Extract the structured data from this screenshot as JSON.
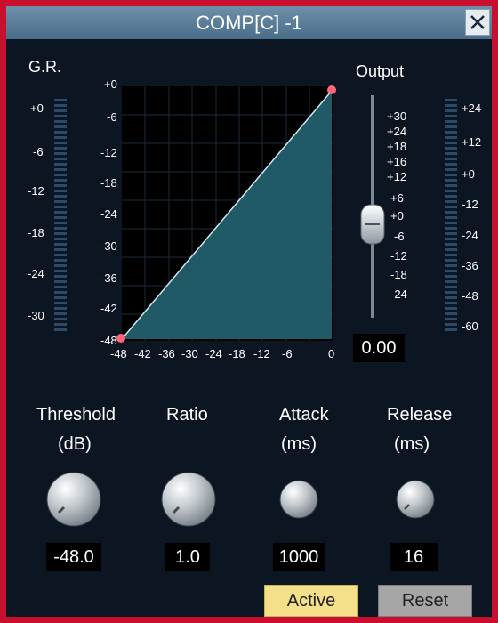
{
  "window": {
    "title": "COMP[C] -1"
  },
  "gr_meter": {
    "label": "G.R.",
    "ticks": [
      "+0",
      "-6",
      "-12",
      "-18",
      "-24",
      "-30"
    ]
  },
  "curve_graph": {
    "y_ticks": [
      "+0",
      "-6",
      "-12",
      "-18",
      "-24",
      "-30",
      "-36",
      "-42",
      "-48"
    ],
    "x_ticks": [
      "-48",
      "-42",
      "-36",
      "-30",
      "-24",
      "-18",
      "-12",
      "-6",
      "0"
    ]
  },
  "output": {
    "label": "Output",
    "fader_ticks": [
      "+30",
      "+24",
      "+18",
      "+16",
      "+12",
      "+6",
      "+0",
      "-6",
      "-12",
      "-18",
      "-24"
    ],
    "value": "0.00",
    "meter_ticks": [
      "+24",
      "+12",
      "+0",
      "-12",
      "-24",
      "-36",
      "-48",
      "-60"
    ]
  },
  "controls": {
    "threshold": {
      "label": "Threshold",
      "unit": "(dB)",
      "value": "-48.0"
    },
    "ratio": {
      "label": "Ratio",
      "value": "1.0"
    },
    "attack": {
      "label": "Attack",
      "unit": "(ms)",
      "value": "1000"
    },
    "release": {
      "label": "Release",
      "unit": "(ms)",
      "value": "16"
    }
  },
  "buttons": {
    "active": "Active",
    "reset": "Reset"
  },
  "colors": {
    "border": "#c8102e",
    "background": "#0c1623",
    "curve_fill": "#1f5a66",
    "active_button": "#f5e08a",
    "reset_button": "#a6a6a6"
  }
}
